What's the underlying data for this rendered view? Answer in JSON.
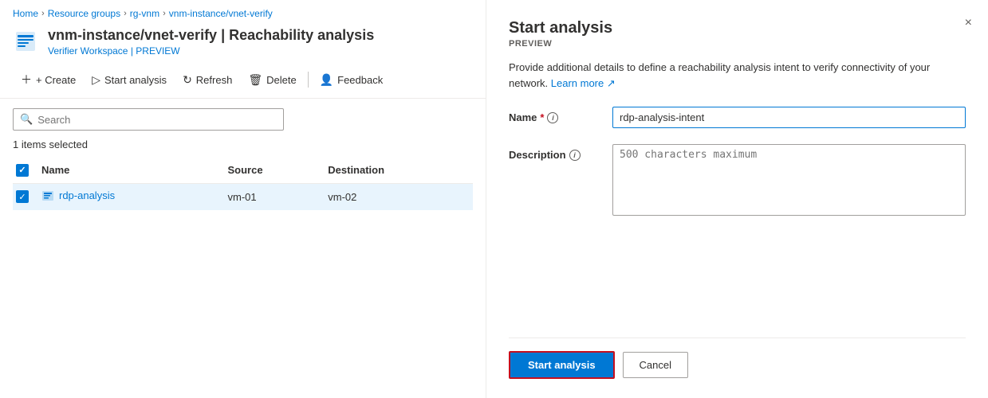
{
  "breadcrumb": {
    "home": "Home",
    "resource_groups": "Resource groups",
    "rg_vnm": "rg-vnm",
    "instance": "vnm-instance/vnet-verify"
  },
  "header": {
    "title": "vnm-instance/vnet-verify | Reachability analysis",
    "subtitle": "Verifier Workspace | PREVIEW"
  },
  "toolbar": {
    "create": "+ Create",
    "start_analysis": "Start analysis",
    "refresh": "Refresh",
    "delete": "Delete",
    "feedback": "Feedback"
  },
  "search": {
    "placeholder": "Search"
  },
  "table": {
    "selected_count": "1 items selected",
    "columns": [
      "Name",
      "Source",
      "Destination"
    ],
    "rows": [
      {
        "name": "rdp-analysis",
        "source": "vm-01",
        "destination": "vm-02"
      }
    ]
  },
  "panel": {
    "title": "Start analysis",
    "preview_label": "PREVIEW",
    "description": "Provide additional details to define a reachability analysis intent to verify connectivity of your network.",
    "learn_more": "Learn more",
    "close_label": "×",
    "name_label": "Name",
    "name_value": "rdp-analysis-intent",
    "description_label": "Description",
    "description_placeholder": "500 characters maximum",
    "start_button": "Start analysis",
    "cancel_button": "Cancel"
  }
}
